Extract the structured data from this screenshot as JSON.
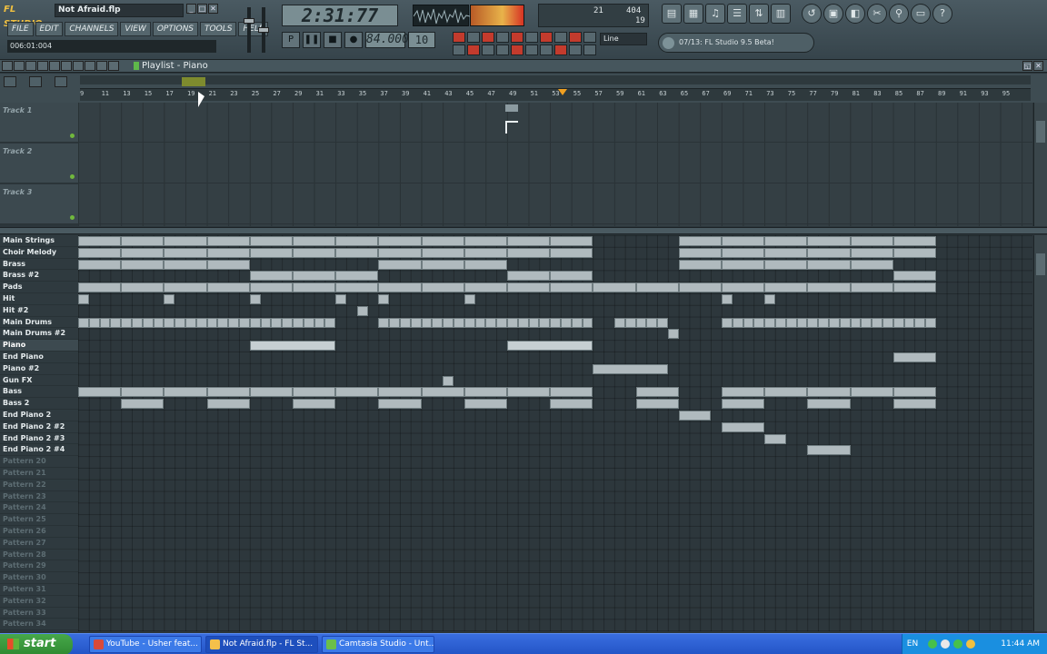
{
  "app": {
    "logo": "FL STUDIO",
    "filename": "Not Afraid.flp",
    "hint": "006:01:004",
    "window_buttons": [
      "_",
      "□",
      "✕"
    ]
  },
  "menu": [
    "FILE",
    "EDIT",
    "CHANNELS",
    "VIEW",
    "OPTIONS",
    "TOOLS",
    "HELP"
  ],
  "transport": {
    "time": "2:31:77",
    "tempo": "84.000",
    "pattern": "10",
    "snap": "Line",
    "cpu_a": "21",
    "cpu_b": "404",
    "cpu_c": "19",
    "news": "07/13: FL Studio 9.5 Beta!"
  },
  "playlist": {
    "title": "Playlist - Piano",
    "ruler": [
      "9",
      "11",
      "13",
      "15",
      "17",
      "19",
      "21",
      "23",
      "25",
      "27",
      "29",
      "31",
      "33",
      "35",
      "37",
      "39",
      "41",
      "43",
      "45",
      "47",
      "49",
      "51",
      "53",
      "55",
      "57",
      "59",
      "61",
      "63",
      "65",
      "67",
      "69",
      "71",
      "73",
      "75",
      "77",
      "79",
      "81",
      "83",
      "85",
      "87",
      "89",
      "91",
      "93",
      "95"
    ],
    "tracks": [
      "Track 1",
      "Track 2",
      "Track 3"
    ]
  },
  "patterns": [
    {
      "name": "Main Strings",
      "dim": false
    },
    {
      "name": "Choir Melody",
      "dim": false
    },
    {
      "name": "Brass",
      "dim": false
    },
    {
      "name": "Brass #2",
      "dim": false
    },
    {
      "name": "Pads",
      "dim": false
    },
    {
      "name": "Hit",
      "dim": false
    },
    {
      "name": "Hit #2",
      "dim": false
    },
    {
      "name": "Main Drums",
      "dim": false
    },
    {
      "name": "Main Drums #2",
      "dim": false
    },
    {
      "name": "Piano",
      "dim": false,
      "selected": true
    },
    {
      "name": "End Piano",
      "dim": false
    },
    {
      "name": "Piano #2",
      "dim": false
    },
    {
      "name": "Gun FX",
      "dim": false
    },
    {
      "name": "Bass",
      "dim": false
    },
    {
      "name": "Bass 2",
      "dim": false
    },
    {
      "name": "End Piano 2",
      "dim": false
    },
    {
      "name": "End Piano 2 #2",
      "dim": false
    },
    {
      "name": "End Piano 2 #3",
      "dim": false
    },
    {
      "name": "End Piano 2 #4",
      "dim": false
    },
    {
      "name": "Pattern 20",
      "dim": true
    },
    {
      "name": "Pattern 21",
      "dim": true
    },
    {
      "name": "Pattern 22",
      "dim": true
    },
    {
      "name": "Pattern 23",
      "dim": true
    },
    {
      "name": "Pattern 24",
      "dim": true
    },
    {
      "name": "Pattern 25",
      "dim": true
    },
    {
      "name": "Pattern 26",
      "dim": true
    },
    {
      "name": "Pattern 27",
      "dim": true
    },
    {
      "name": "Pattern 28",
      "dim": true
    },
    {
      "name": "Pattern 29",
      "dim": true
    },
    {
      "name": "Pattern 30",
      "dim": true
    },
    {
      "name": "Pattern 31",
      "dim": true
    },
    {
      "name": "Pattern 32",
      "dim": true
    },
    {
      "name": "Pattern 33",
      "dim": true
    },
    {
      "name": "Pattern 34",
      "dim": true
    }
  ],
  "taskbar": {
    "start": "start",
    "tasks": [
      "YouTube - Usher feat...",
      "Not Afraid.flp - FL St...",
      "Camtasia Studio - Unt..."
    ],
    "lang": "EN",
    "clock": "11:44 AM"
  },
  "colors": {
    "accent": "#f0a020",
    "clip": "#b0babe",
    "grid": "#2d373c"
  }
}
